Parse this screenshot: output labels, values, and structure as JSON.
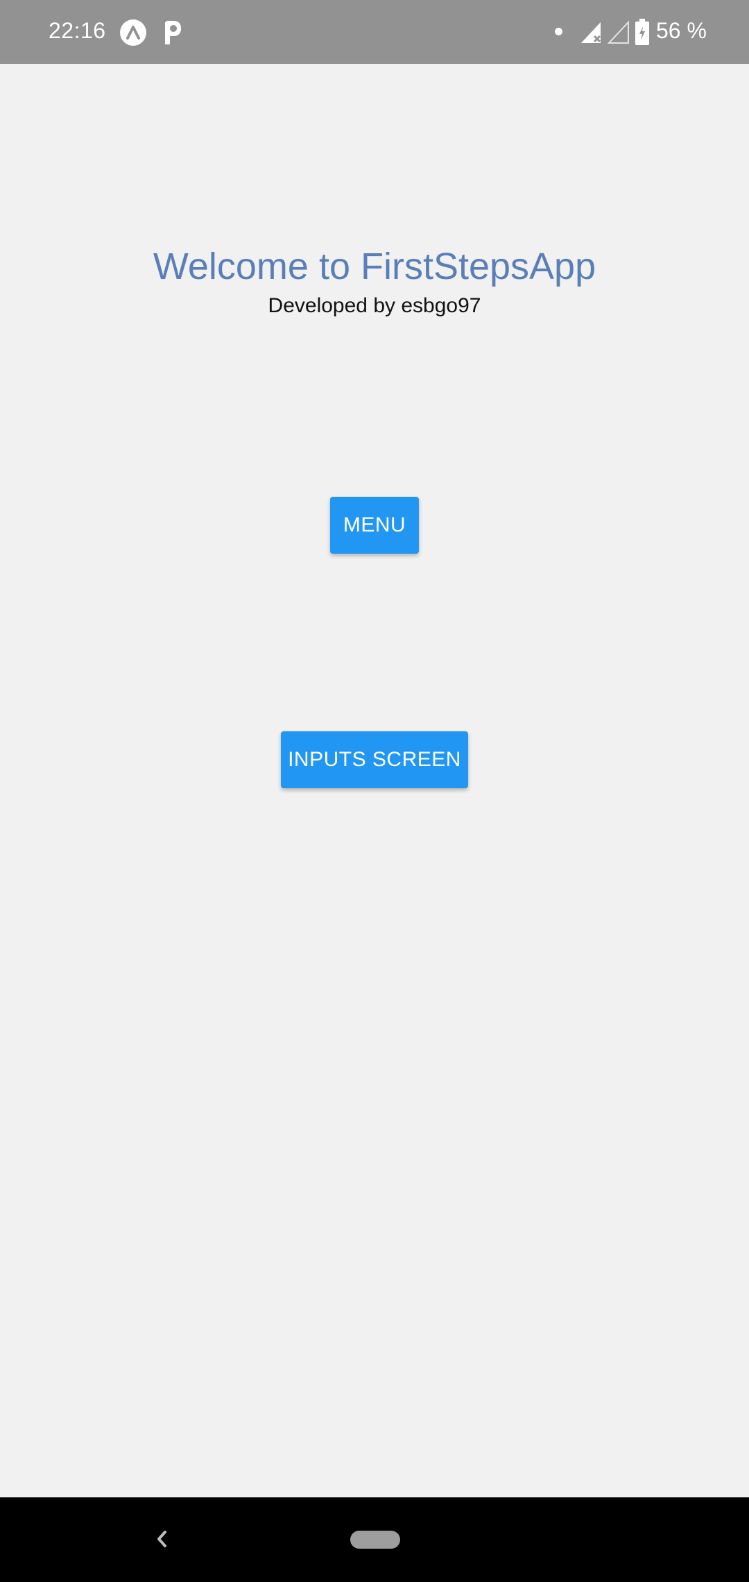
{
  "status_bar": {
    "time": "22:16",
    "battery_text": "56 %",
    "notification_icons": [
      "a-logo-icon",
      "p-logo-icon"
    ],
    "system_icons": [
      "dot-icon",
      "signal-x-icon",
      "signal-empty-icon",
      "battery-charging-icon"
    ]
  },
  "main": {
    "title": "Welcome to FirstStepsApp",
    "subtitle": "Developed by esbgo97",
    "menu_button": "MENU",
    "inputs_button": "INPUTS SCREEN"
  },
  "nav_bar": {
    "icons": [
      "back-icon",
      "home-pill-icon"
    ]
  },
  "colors": {
    "status_bar_bg": "#929292",
    "screen_bg": "#f1f1f1",
    "title_color": "#5a7fb8",
    "button_bg": "#2196f3",
    "button_text": "#ffffff",
    "nav_bar_bg": "#000000"
  }
}
